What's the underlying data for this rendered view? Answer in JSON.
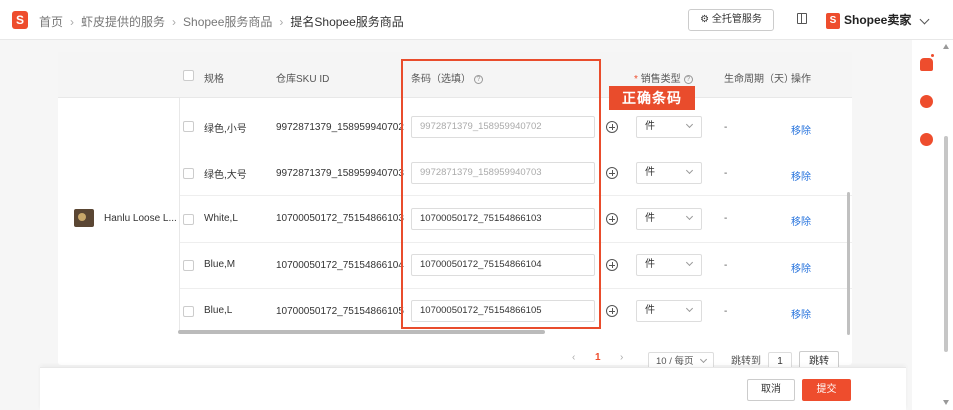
{
  "breadcrumb": [
    "首页",
    "虾皮提供的服务",
    "Shopee服务商品",
    "提名Shopee服务商品"
  ],
  "header": {
    "managed_service_button": "全托管服务",
    "brand_text": "Shopee卖家"
  },
  "table": {
    "columns": {
      "spec": "规格",
      "sku": "仓库SKU ID",
      "barcode": "条码（选填）",
      "sale_type": "销售类型",
      "lifecycle": "生命周期（天）",
      "action": "操作"
    },
    "product_name": "Hanlu Loose L...",
    "rows": [
      {
        "spec": "绿色,小号",
        "sku": "9972871379_158959940702",
        "barcode": "9972871379_158959940702",
        "barcode_state": "placeholder",
        "sale_type": "件",
        "lifecycle": "-",
        "action": "移除"
      },
      {
        "spec": "绿色,大号",
        "sku": "9972871379_158959940703",
        "barcode": "9972871379_158959940703",
        "barcode_state": "placeholder",
        "sale_type": "件",
        "lifecycle": "-",
        "action": "移除"
      },
      {
        "spec": "White,L",
        "sku": "10700050172_75154866103",
        "barcode": "10700050172_75154866103",
        "barcode_state": "filled",
        "sale_type": "件",
        "lifecycle": "-",
        "action": "移除"
      },
      {
        "spec": "Blue,M",
        "sku": "10700050172_75154866104",
        "barcode": "10700050172_75154866104",
        "barcode_state": "filled",
        "sale_type": "件",
        "lifecycle": "-",
        "action": "移除"
      },
      {
        "spec": "Blue,L",
        "sku": "10700050172_75154866105",
        "barcode": "10700050172_75154866105",
        "barcode_state": "filled",
        "sale_type": "件",
        "lifecycle": "-",
        "action": "移除"
      }
    ]
  },
  "annotation": {
    "label": "正确条码",
    "color": "#e94c2c"
  },
  "pagination": {
    "prev": "‹",
    "current_page": "1",
    "next": "›",
    "page_size": "10 / 每页",
    "jump_label": "跳转到",
    "jump_value": "1",
    "jump_button": "跳转"
  },
  "footer": {
    "cancel": "取消",
    "submit": "提交"
  },
  "colors": {
    "accent": "#ee4d2d",
    "link": "#2673dd"
  }
}
